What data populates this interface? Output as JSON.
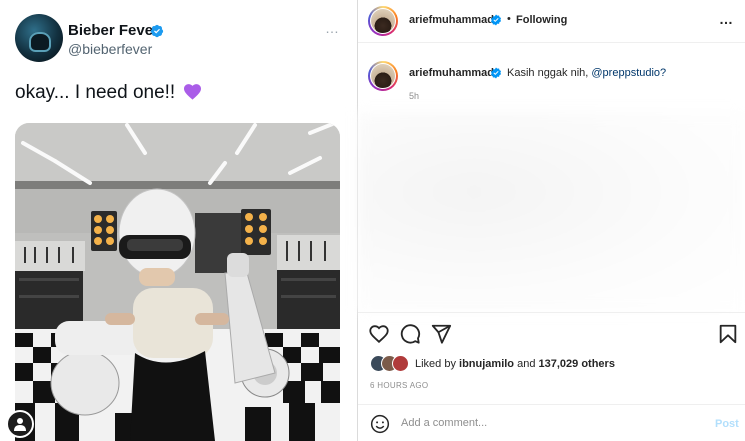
{
  "tweet": {
    "display_name": "Bieber Fever",
    "handle": "@bieberfever",
    "more_icon": "…",
    "text": "okay... I need one!!",
    "emoji": "purple-heart",
    "verified_color": "#1d9bf0"
  },
  "instagram": {
    "header": {
      "username": "ariefmuhammad",
      "separator": "•",
      "follow_status": "Following",
      "more_icon": "…"
    },
    "caption": {
      "username": "ariefmuhammad",
      "text": "Kasih nggak nih, ",
      "mention": "@preppstudio?",
      "time": "5h"
    },
    "actions": [
      "heart-icon",
      "comment-icon",
      "share-icon",
      "bookmark-icon"
    ],
    "likes": {
      "prefix": "Liked by ",
      "first_liker": "ibnujamilo",
      "middle": " and ",
      "others": "137,029 others"
    },
    "post_time": "6 HOURS AGO",
    "comment_placeholder": "Add a comment...",
    "post_label": "Post",
    "accent_color": "#0095f6"
  }
}
